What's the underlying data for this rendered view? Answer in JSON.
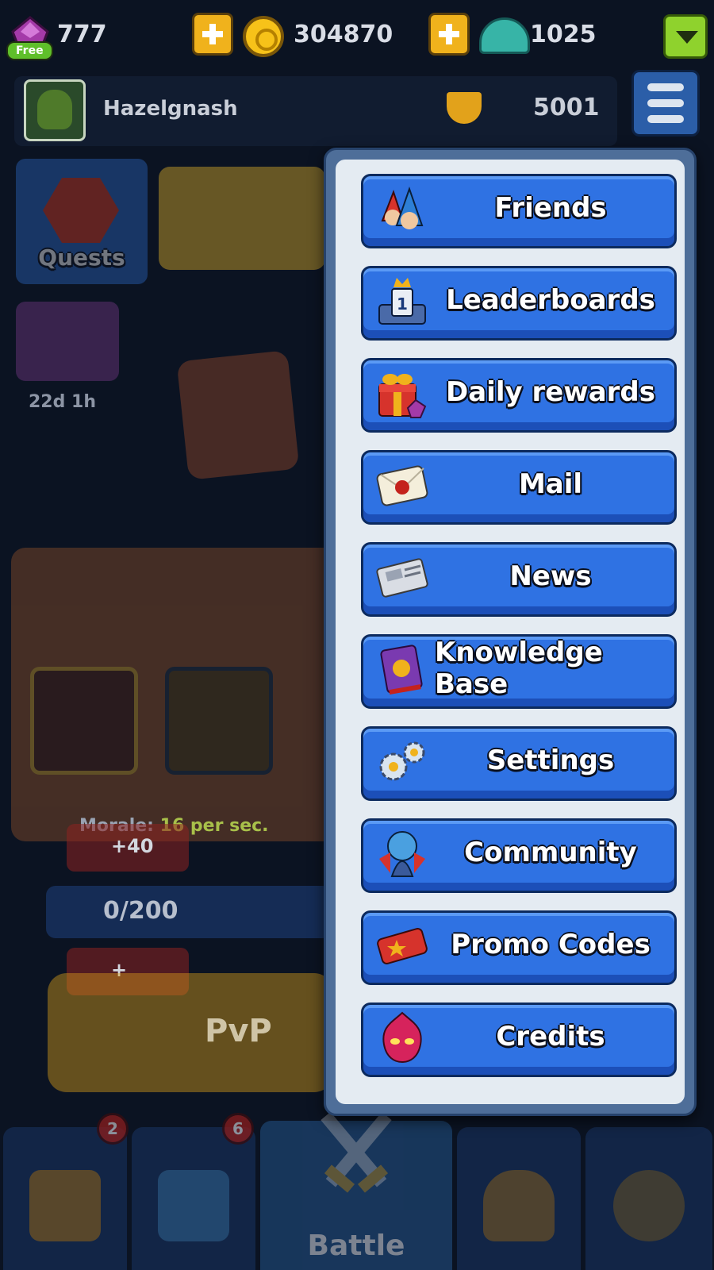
{
  "top_bar": {
    "gems": "777",
    "free_label": "Free",
    "coins": "304870",
    "helmets": "1025"
  },
  "profile": {
    "name": "Hazelgnash",
    "trophies": "5001"
  },
  "background": {
    "quests_label": "Quests",
    "chest_timer": "22d 1h",
    "morale_label": "Morale:",
    "morale_value": "16 per sec.",
    "ad_reward_1": "+40",
    "ad_reward_2": "+",
    "progress": "0/200",
    "pvp_label": "PvP"
  },
  "menu": {
    "items": [
      {
        "label": "Friends",
        "icon": "friends-icon"
      },
      {
        "label": "Leaderboards",
        "icon": "leaderboard-icon"
      },
      {
        "label": "Daily rewards",
        "icon": "gift-icon"
      },
      {
        "label": "Mail",
        "icon": "mail-icon"
      },
      {
        "label": "News",
        "icon": "newspaper-icon"
      },
      {
        "label": "Knowledge Base",
        "icon": "book-icon"
      },
      {
        "label": "Settings",
        "icon": "gears-icon"
      },
      {
        "label": "Community",
        "icon": "community-icon"
      },
      {
        "label": "Promo Codes",
        "icon": "ticket-icon"
      },
      {
        "label": "Credits",
        "icon": "flame-mask-icon"
      }
    ]
  },
  "bottom_nav": {
    "tabs": [
      {
        "name": "chests",
        "badge": "2"
      },
      {
        "name": "cards",
        "badge": "6"
      },
      {
        "name": "battle",
        "label": "Battle"
      },
      {
        "name": "clan"
      },
      {
        "name": "ranks"
      }
    ]
  },
  "colors": {
    "menu_button": "#2f72e3",
    "popup_bg": "#e4ebf2",
    "accent_yellow": "#f0b21c"
  }
}
